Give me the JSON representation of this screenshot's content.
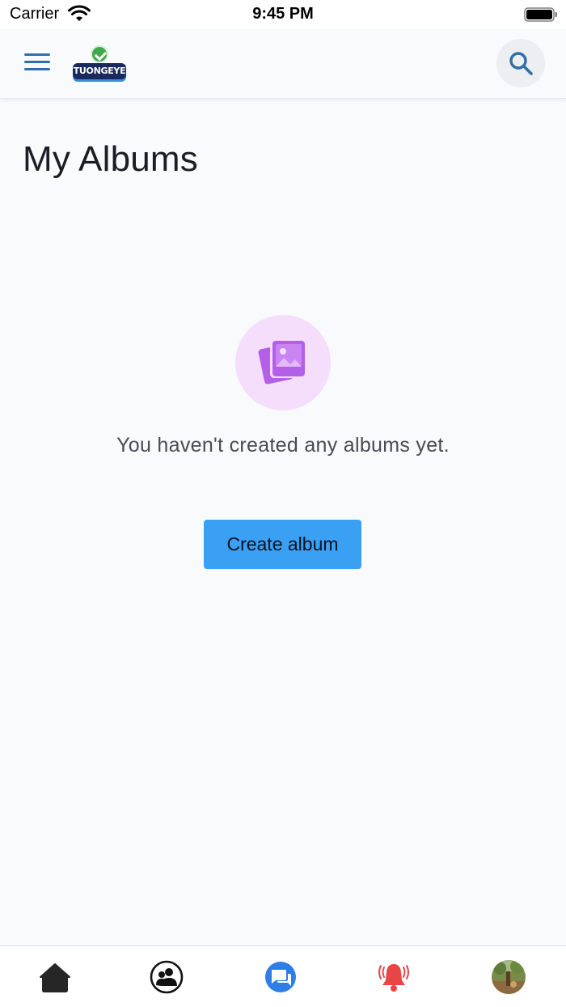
{
  "status_bar": {
    "carrier": "Carrier",
    "time": "9:45 PM"
  },
  "header": {
    "logo_text": "TUONGEYE",
    "menu_icon": "hamburger-menu-icon",
    "search_icon": "search-icon"
  },
  "main": {
    "title": "My Albums",
    "empty_message": "You haven't created any albums yet.",
    "empty_icon": "photo-album-icon",
    "create_button_label": "Create album"
  },
  "bottom_nav": {
    "items": [
      {
        "icon": "home-icon"
      },
      {
        "icon": "friends-icon"
      },
      {
        "icon": "messages-icon"
      },
      {
        "icon": "notifications-bell-icon"
      },
      {
        "icon": "profile-avatar"
      }
    ]
  },
  "colors": {
    "accent": "#3aa0f3",
    "menu_icon": "#2f6fa8",
    "album_icon": "#b35fe8",
    "album_icon_bg": "#f5defc",
    "messages": "#2e7ee6",
    "notifications": "#e84545"
  }
}
